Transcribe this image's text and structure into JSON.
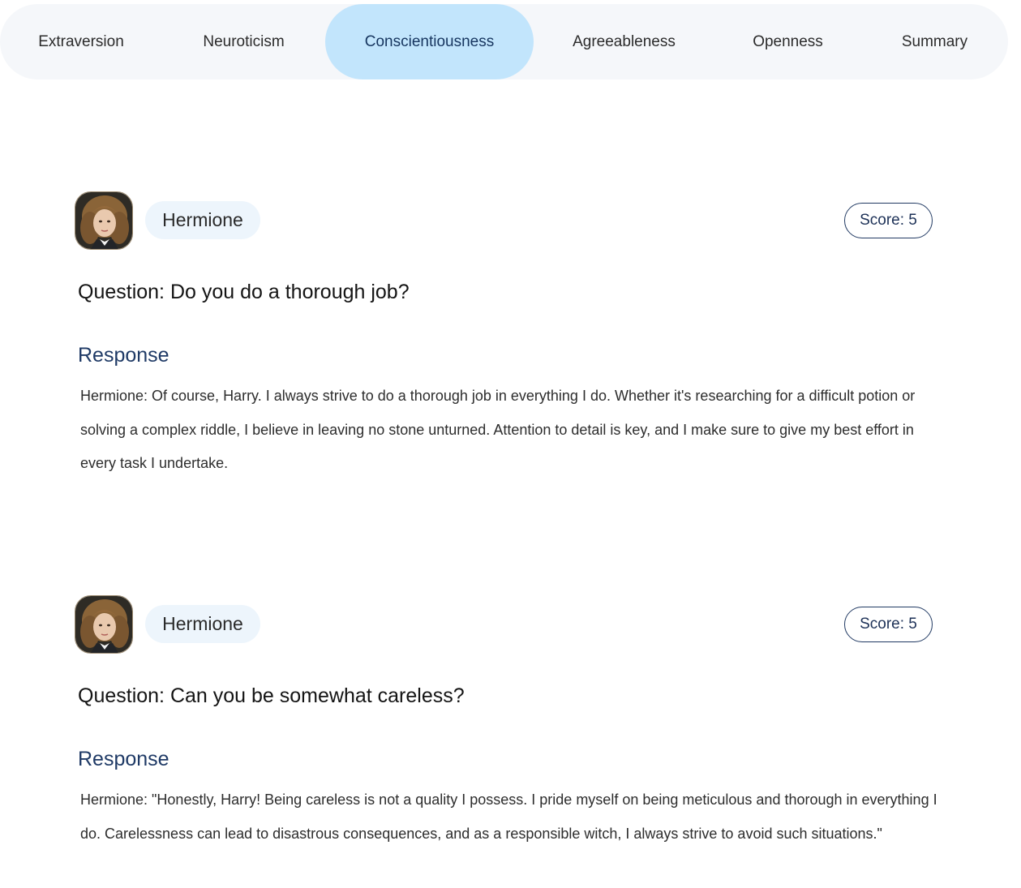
{
  "tabs": [
    {
      "label": "Extraversion",
      "active": false
    },
    {
      "label": "Neuroticism",
      "active": false
    },
    {
      "label": "Conscientiousness",
      "active": true
    },
    {
      "label": "Agreeableness",
      "active": false
    },
    {
      "label": "Openness",
      "active": false
    },
    {
      "label": "Summary",
      "active": false
    }
  ],
  "cards": [
    {
      "name": "Hermione",
      "score": "Score: 5",
      "question": "Question: Do you do a thorough job?",
      "response_heading": "Response",
      "response": "Hermione: Of course, Harry. I always strive to do a thorough job in everything I do. Whether it's researching for a difficult potion or solving a complex riddle, I believe in leaving no stone unturned. Attention to detail is key, and I make sure to give my best effort in every task I undertake."
    },
    {
      "name": "Hermione",
      "score": "Score: 5",
      "question": "Question: Can you be somewhat careless?",
      "response_heading": "Response",
      "response": "Hermione: \"Honestly, Harry! Being careless is not a quality I possess. I pride myself on being meticulous and thorough in everything I do. Carelessness can lead to disastrous consequences, and as a responsible witch, I always strive to avoid such situations.\""
    }
  ],
  "colors": {
    "tabbar_bg": "#f5f7fa",
    "active_tab_bg": "#c2e5fc",
    "name_chip_bg": "#edf5fc",
    "response_heading": "#1f3a66",
    "score_border": "#213a63"
  },
  "icons": {
    "avatar": "character-portrait"
  }
}
